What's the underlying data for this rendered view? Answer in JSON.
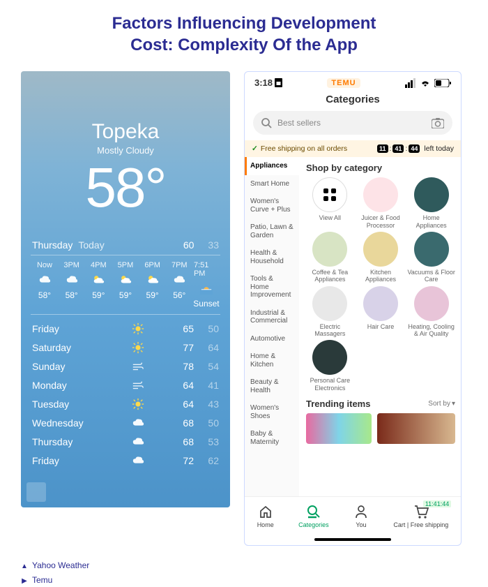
{
  "title_line1": "Factors Influencing Development",
  "title_line2": "Cost: Complexity Of the App",
  "weather": {
    "city": "Topeka",
    "condition": "Mostly Cloudy",
    "current_temp": "58°",
    "today_day": "Thursday",
    "today_label": "Today",
    "today_hi": "60",
    "today_lo": "33",
    "hours": [
      {
        "time": "Now",
        "icon": "cloud",
        "value": "58°"
      },
      {
        "time": "3PM",
        "icon": "cloud",
        "value": "58°"
      },
      {
        "time": "4PM",
        "icon": "partly",
        "value": "59°"
      },
      {
        "time": "5PM",
        "icon": "partly",
        "value": "59°"
      },
      {
        "time": "6PM",
        "icon": "partly",
        "value": "59°"
      },
      {
        "time": "7PM",
        "icon": "cloud",
        "value": "56°"
      },
      {
        "time": "7:51 PM",
        "icon": "sunset",
        "value": "Sunset"
      }
    ],
    "forecast": [
      {
        "day": "Friday",
        "icon": "sun",
        "hi": "65",
        "lo": "50"
      },
      {
        "day": "Saturday",
        "icon": "sun",
        "hi": "77",
        "lo": "64"
      },
      {
        "day": "Sunday",
        "icon": "wind",
        "hi": "78",
        "lo": "54"
      },
      {
        "day": "Monday",
        "icon": "wind",
        "hi": "64",
        "lo": "41"
      },
      {
        "day": "Tuesday",
        "icon": "sun",
        "hi": "64",
        "lo": "43"
      },
      {
        "day": "Wednesday",
        "icon": "cloud",
        "hi": "68",
        "lo": "50"
      },
      {
        "day": "Thursday",
        "icon": "cloud",
        "hi": "68",
        "lo": "53"
      },
      {
        "day": "Friday",
        "icon": "cloud",
        "hi": "72",
        "lo": "62"
      }
    ]
  },
  "temu": {
    "time": "3:18",
    "brand": "TEMU",
    "header": "Categories",
    "search_placeholder": "Best sellers",
    "banner_check": "✓",
    "banner_text": "Free shipping on all orders",
    "timer_h": "11",
    "timer_m": "41",
    "timer_s": "44",
    "banner_tail": "left today",
    "sidebar": [
      "Appliances",
      "Smart Home",
      "Women's Curve + Plus",
      "Patio, Lawn & Garden",
      "Health & Household",
      "Tools & Home Improvement",
      "Industrial & Commercial",
      "Automotive",
      "Home & Kitchen",
      "Beauty & Health",
      "Women's Shoes",
      "Baby & Maternity"
    ],
    "shop_header": "Shop by category",
    "cats": [
      {
        "label": "View All",
        "bg": "#ffffff",
        "icon": "grid"
      },
      {
        "label": "Juicer & Food Processor",
        "bg": "#fde3e7"
      },
      {
        "label": "Home Appliances",
        "bg": "#2f5a5c"
      },
      {
        "label": "Coffee & Tea Appliances",
        "bg": "#d8e4c4"
      },
      {
        "label": "Kitchen Appliances",
        "bg": "#e9d79b"
      },
      {
        "label": "Vacuums & Floor Care",
        "bg": "#3a6a6e"
      },
      {
        "label": "Electric Massagers",
        "bg": "#e8e8e8"
      },
      {
        "label": "Hair Care",
        "bg": "#d8d2e8"
      },
      {
        "label": "Heating, Cooling & Air Quality",
        "bg": "#e8c4d8"
      },
      {
        "label": "Personal Care Electronics",
        "bg": "#2a3a3a"
      }
    ],
    "trending_header": "Trending items",
    "sort_label": "Sort by",
    "tabs": [
      {
        "label": "Home"
      },
      {
        "label": "Categories"
      },
      {
        "label": "You"
      },
      {
        "label": "Cart | Free shipping",
        "badge": "11:41:44"
      }
    ]
  },
  "legend": {
    "a": "Yahoo Weather",
    "b": "Temu"
  }
}
